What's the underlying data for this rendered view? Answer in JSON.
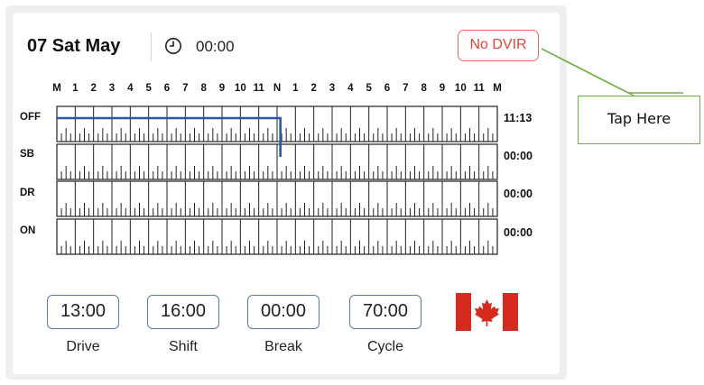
{
  "header": {
    "date": "07 Sat May",
    "clock_icon": "clock-icon",
    "time": "00:00",
    "dvir_button": "No DVIR"
  },
  "hours": [
    "M",
    "1",
    "2",
    "3",
    "4",
    "5",
    "6",
    "7",
    "8",
    "9",
    "10",
    "11",
    "N",
    "1",
    "2",
    "3",
    "4",
    "5",
    "6",
    "7",
    "8",
    "9",
    "10",
    "11",
    "M"
  ],
  "statuses": [
    {
      "label": "OFF",
      "total": "11:13"
    },
    {
      "label": "SB",
      "total": "00:00"
    },
    {
      "label": "DR",
      "total": "00:00"
    },
    {
      "label": "ON",
      "total": "00:00"
    }
  ],
  "duty_line": {
    "color": "#2f56a6",
    "segments": [
      {
        "status": "OFF",
        "start_hour": 0,
        "end_hour": 12.18
      },
      {
        "status": "SB",
        "start_hour": 12.18,
        "end_hour": 12.18
      }
    ]
  },
  "counters": [
    {
      "value": "13:00",
      "label": "Drive"
    },
    {
      "value": "16:00",
      "label": "Shift"
    },
    {
      "value": "00:00",
      "label": "Break"
    },
    {
      "value": "70:00",
      "label": "Cycle"
    }
  ],
  "flag": {
    "icon": "canada-flag-icon",
    "red": "#d52b1e"
  },
  "callout": {
    "text": "Tap Here",
    "border_color": "#70ad47"
  },
  "colors": {
    "dvir": "#e0453b",
    "counter_border": "#5a7bb0"
  }
}
